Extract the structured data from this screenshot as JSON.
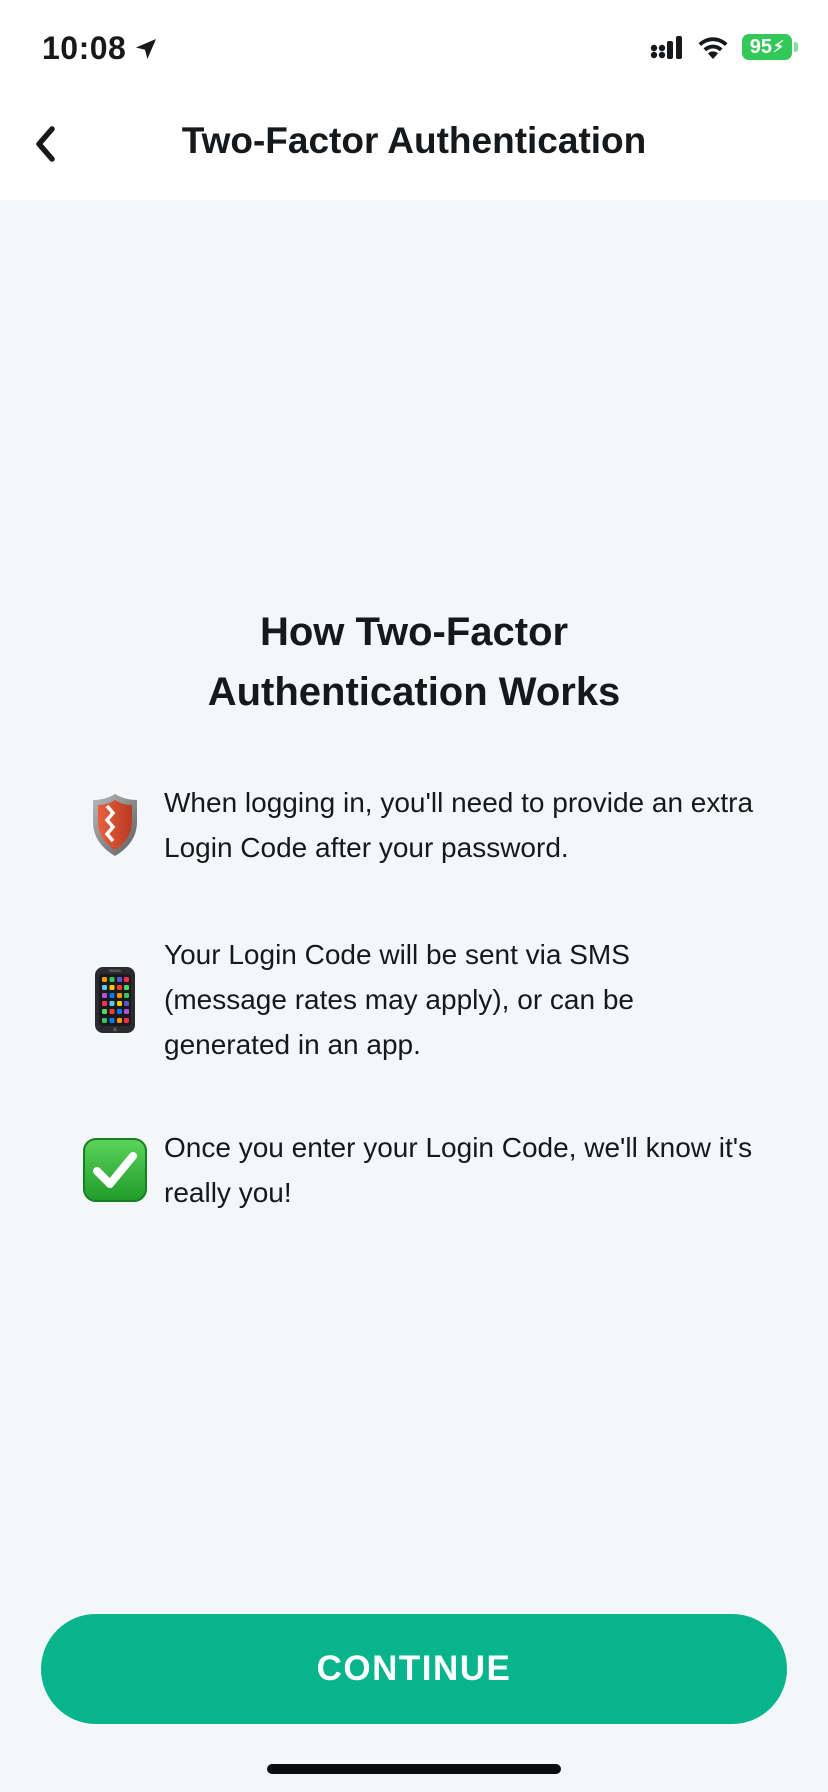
{
  "status_bar": {
    "time": "10:08",
    "battery_level": "95"
  },
  "nav": {
    "title": "Two-Factor Authentication"
  },
  "main": {
    "heading_line1": "How Two-Factor",
    "heading_line2": "Authentication Works",
    "items": [
      {
        "icon": "shield-icon",
        "text": "When logging in, you'll need to provide an extra Login Code after your password."
      },
      {
        "icon": "mobile-phone-icon",
        "text": "Your Login Code will be sent via SMS (message rates may apply), or can be generated in an app."
      },
      {
        "icon": "check-mark-icon",
        "text": "Once you enter your Login Code, we'll know it's really you!"
      }
    ]
  },
  "continue_button": {
    "label": "CONTINUE"
  },
  "colors": {
    "accent": "#07b48b",
    "background": "#f3f7fa",
    "battery": "#34c759"
  }
}
